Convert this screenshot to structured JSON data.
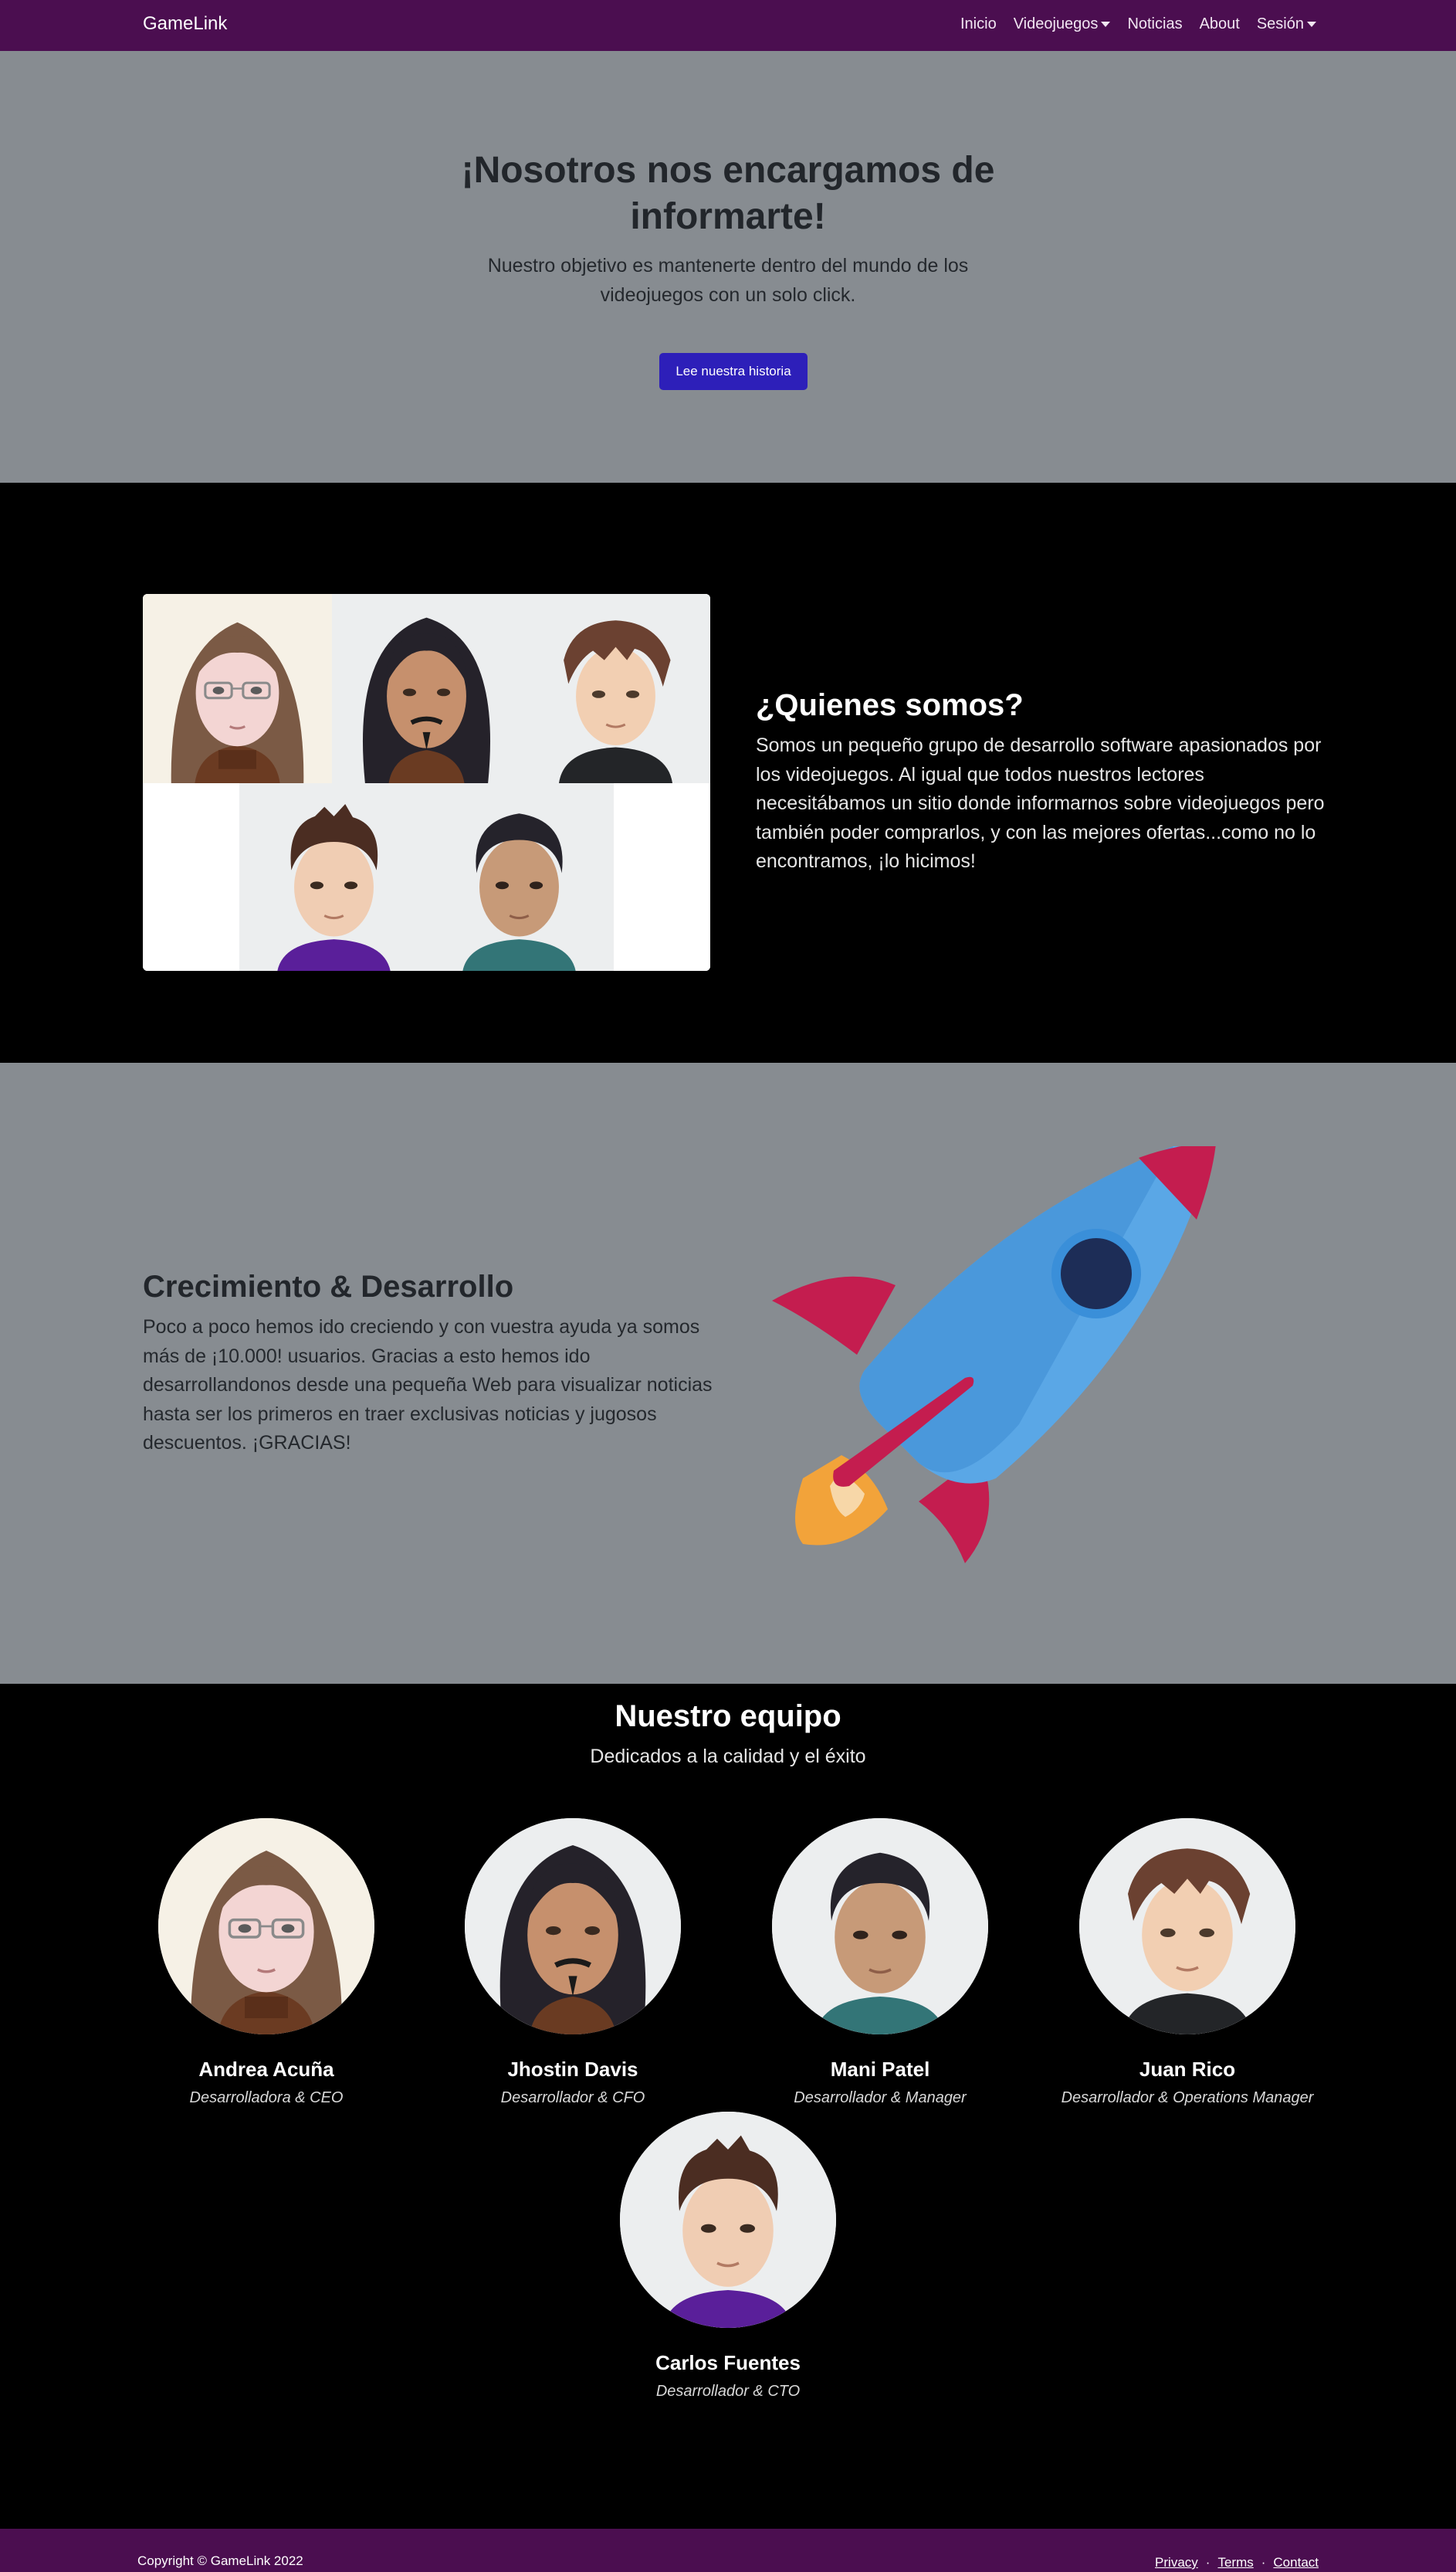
{
  "navbar": {
    "brand": "GameLink",
    "links": {
      "inicio": "Inicio",
      "videojuegos": "Videojuegos",
      "noticias": "Noticias",
      "about": "About",
      "sesion": "Sesión"
    }
  },
  "hero": {
    "title": "¡Nosotros nos encargamos de informarte!",
    "lead": "Nuestro objetivo es mantenerte dentro del mundo de los videojuegos con un solo click.",
    "button": "Lee nuestra historia"
  },
  "about": {
    "title": "¿Quienes somos?",
    "text": "Somos un pequeño grupo de desarrollo software apasionados por los videojuegos. Al igual que todos nuestros lectores necesitábamos un sitio donde informarnos sobre videojuegos pero también poder comprarlos, y con las mejores ofertas...como no lo encontramos, ¡lo hicimos!"
  },
  "growth": {
    "title": "Crecimiento & Desarrollo",
    "text": "Poco a poco hemos ido creciendo y con vuestra ayuda ya somos más de ¡10.000! usuarios. Gracias a esto hemos ido desarrollandonos desde una pequeña Web para visualizar noticias hasta ser los primeros en traer exclusivas noticias y jugosos descuentos. ¡GRACIAS!"
  },
  "team": {
    "title": "Nuestro equipo",
    "subtitle": "Dedicados a la calidad y el éxito",
    "members": [
      {
        "name": "Andrea Acuña",
        "role": "Desarrolladora & CEO"
      },
      {
        "name": "Jhostin Davis",
        "role": "Desarrollador & CFO"
      },
      {
        "name": "Mani Patel",
        "role": "Desarrollador & Manager"
      },
      {
        "name": "Juan Rico",
        "role": "Desarrollador & Operations Manager"
      },
      {
        "name": "Carlos Fuentes",
        "role": "Desarrollador & CTO"
      }
    ]
  },
  "footer": {
    "copyright": "Copyright © GameLink 2022",
    "links": {
      "privacy": "Privacy",
      "terms": "Terms",
      "contact": "Contact"
    },
    "separator": "·"
  },
  "colors": {
    "navbar": "#4b0e50",
    "hero_bg": "#878c91",
    "button": "#2d1fb9",
    "rocket_body": "#5aa7e6",
    "rocket_fins": "#c41d4f",
    "flame": "#f2a33a"
  }
}
